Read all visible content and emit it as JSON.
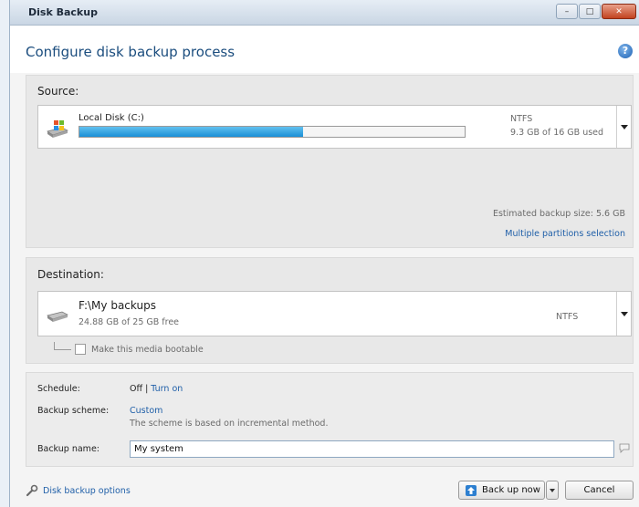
{
  "window": {
    "title": "Disk Backup",
    "controls": [
      "minimize",
      "maximize",
      "close"
    ]
  },
  "header": {
    "caption": "Configure disk backup process",
    "help_icon": "help-icon"
  },
  "source": {
    "label": "Source:",
    "disk_name": "Local Disk (C:)",
    "filesystem": "NTFS",
    "usage_text": "9.3 GB of 16 GB used",
    "usage_fraction": 0.58,
    "estimated_size": "Estimated backup size: 5.6 GB",
    "multiple_partitions_link": "Multiple partitions selection"
  },
  "destination": {
    "label": "Destination:",
    "path": "F:\\My backups",
    "free_text": "24.88 GB of 25 GB free",
    "filesystem": "NTFS",
    "bootable_label": "Make this media bootable",
    "bootable_checked": false
  },
  "schedule": {
    "schedule_label": "Schedule:",
    "schedule_value": "Off",
    "separator": "|",
    "turn_on_link": "Turn on",
    "scheme_label": "Backup scheme:",
    "scheme_value": "Custom",
    "scheme_desc": "The scheme is based on incremental method.",
    "name_label": "Backup name:",
    "name_value": "My system"
  },
  "footer": {
    "options_link": "Disk backup options",
    "back_up_now": "Back up now",
    "cancel": "Cancel"
  },
  "colors": {
    "accent_link": "#1f5fa8",
    "usage_bar": "#1a8fd6",
    "caption": "#1b4d7e"
  }
}
